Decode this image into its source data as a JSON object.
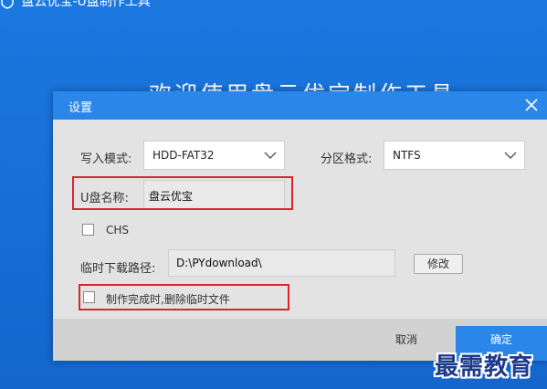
{
  "app": {
    "title": "盘云优宝-U盘制作工具",
    "headline": "欢迎使用盘云优宝制作工具"
  },
  "dialog": {
    "title": "设置",
    "write_mode": {
      "label": "写入模式:",
      "value": "HDD-FAT32"
    },
    "partition_format": {
      "label": "分区格式:",
      "value": "NTFS"
    },
    "usb_name": {
      "label": "U盘名称:",
      "value": "盘云优宝"
    },
    "chs": {
      "label": "CHS",
      "checked": false
    },
    "temp_path": {
      "label": "临时下载路径:",
      "value": "D:\\PYdownload\\",
      "edit_label": "修改"
    },
    "delete_temp": {
      "label": "制作完成时,删除临时文件",
      "checked": false
    },
    "cancel_label": "取消",
    "ok_label": "确定"
  },
  "colors": {
    "background": "#1670d8",
    "accent": "#2a86e8",
    "highlight": "#d9262b"
  },
  "watermark": "最需教育"
}
